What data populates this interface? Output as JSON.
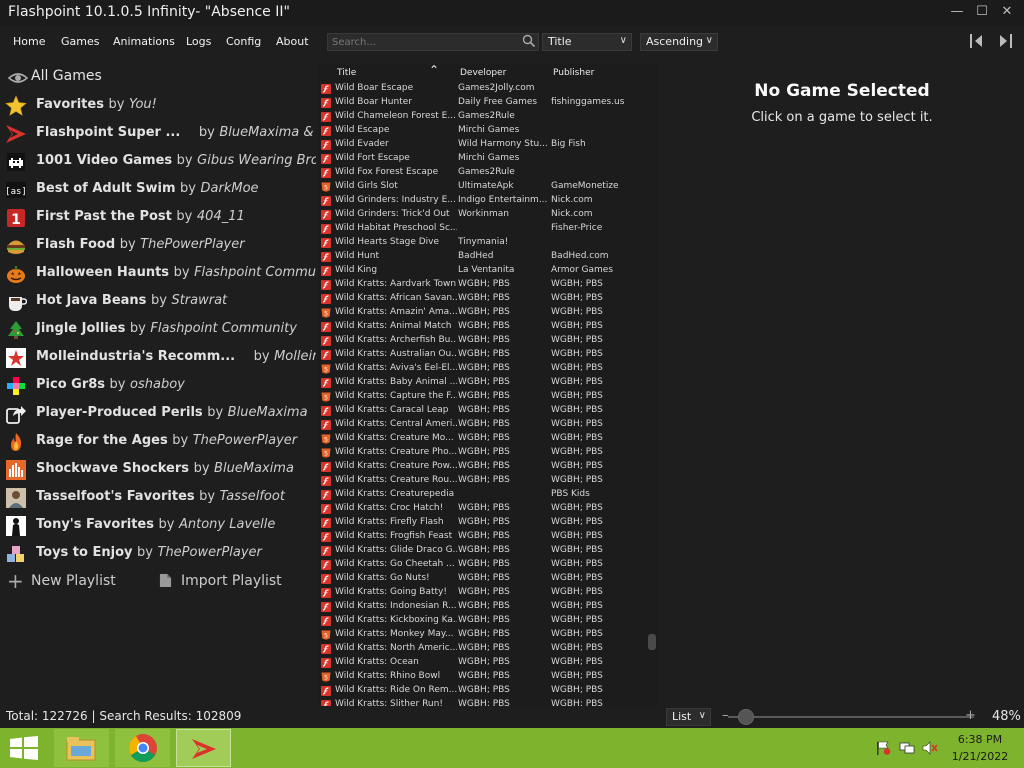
{
  "window": {
    "title": "Flashpoint 10.1.0.5 Infinity- \"Absence II\"",
    "minimize": "—",
    "maximize": "☐",
    "close": "✕"
  },
  "menu": {
    "items": [
      "Home",
      "Games",
      "Animations",
      "Logs",
      "Config",
      "About"
    ],
    "search_placeholder": "Search...",
    "order_by": "Title",
    "order_direction": "Ascending"
  },
  "playlists": {
    "all_games": "All Games",
    "items": [
      {
        "name": "Favorites",
        "by": "by",
        "author": "You!",
        "icon": "star-icon"
      },
      {
        "name": "Flashpoint Super ...",
        "by": "by",
        "author": "BlueMaxima & Fla...",
        "icon": "flashpoint-logo-icon"
      },
      {
        "name": "1001 Video Games",
        "by": "by",
        "author": "Gibus Wearing Brony",
        "icon": "space-invader-icon"
      },
      {
        "name": "Best of Adult Swim",
        "by": "by",
        "author": "DarkMoe",
        "icon": "adult-swim-icon"
      },
      {
        "name": "First Past the Post",
        "by": "by",
        "author": "404_11",
        "icon": "number-one-icon"
      },
      {
        "name": "Flash Food",
        "by": "by",
        "author": "ThePowerPlayer",
        "icon": "burger-icon"
      },
      {
        "name": "Halloween Haunts",
        "by": "by",
        "author": "Flashpoint Community",
        "icon": "pumpkin-icon"
      },
      {
        "name": "Hot Java Beans",
        "by": "by",
        "author": "Strawrat",
        "icon": "coffee-cup-icon"
      },
      {
        "name": "Jingle Jollies",
        "by": "by",
        "author": "Flashpoint Community",
        "icon": "christmas-tree-icon"
      },
      {
        "name": "Molleindustria's Recomm...",
        "by": "by",
        "author": "Molleind...",
        "icon": "molleindustria-icon"
      },
      {
        "name": "Pico Gr8s",
        "by": "by",
        "author": "oshaboy",
        "icon": "pico-icon"
      },
      {
        "name": "Player-Produced Perils",
        "by": "by",
        "author": "BlueMaxima",
        "icon": "share-arrow-icon"
      },
      {
        "name": "Rage for the Ages",
        "by": "by",
        "author": "ThePowerPlayer",
        "icon": "fire-icon"
      },
      {
        "name": "Shockwave Shockers",
        "by": "by",
        "author": "BlueMaxima",
        "icon": "shockwave-icon"
      },
      {
        "name": "Tasselfoot's Favorites",
        "by": "by",
        "author": "Tasselfoot",
        "icon": "tasselfoot-avatar-icon"
      },
      {
        "name": "Tony's Favorites",
        "by": "by",
        "author": "Antony Lavelle",
        "icon": "silhouette-icon"
      },
      {
        "name": "Toys to Enjoy",
        "by": "by",
        "author": "ThePowerPlayer",
        "icon": "toy-blocks-icon"
      }
    ],
    "new_playlist": "New Playlist",
    "import_playlist": "Import Playlist"
  },
  "game_list": {
    "columns": {
      "title": "Title",
      "developer": "Developer",
      "publisher": "Publisher"
    },
    "rows": [
      {
        "t": "Wild Boar Escape",
        "d": "Games2Jolly.com",
        "p": "",
        "k": "flash"
      },
      {
        "t": "Wild Boar Hunter",
        "d": "Daily Free Games",
        "p": "fishinggames.us",
        "k": "flash"
      },
      {
        "t": "Wild Chameleon Forest E...",
        "d": "Games2Rule",
        "p": "",
        "k": "flash"
      },
      {
        "t": "Wild Escape",
        "d": "Mirchi Games",
        "p": "",
        "k": "flash"
      },
      {
        "t": "Wild Evader",
        "d": "Wild Harmony Stu...",
        "p": "Big Fish",
        "k": "flash"
      },
      {
        "t": "Wild Fort Escape",
        "d": "Mirchi Games",
        "p": "",
        "k": "flash"
      },
      {
        "t": "Wild Fox Forest Escape",
        "d": "Games2Rule",
        "p": "",
        "k": "flash"
      },
      {
        "t": "Wild Girls Slot",
        "d": "UltimateApk",
        "p": "GameMonetize",
        "k": "html5"
      },
      {
        "t": "Wild Grinders: Industry E...",
        "d": "Indigo Entertainm...",
        "p": "Nick.com",
        "k": "flash"
      },
      {
        "t": "Wild Grinders: Trick'd Out",
        "d": "Workinman",
        "p": "Nick.com",
        "k": "flash"
      },
      {
        "t": "Wild Habitat Preschool Sc...",
        "d": "",
        "p": "Fisher-Price",
        "k": "flash"
      },
      {
        "t": "Wild Hearts Stage Dive",
        "d": "Tinymania!",
        "p": "",
        "k": "flash"
      },
      {
        "t": "Wild Hunt",
        "d": "BadHed",
        "p": "BadHed.com",
        "k": "flash"
      },
      {
        "t": "Wild King",
        "d": "La Ventanita",
        "p": "Armor Games",
        "k": "flash"
      },
      {
        "t": "Wild Kratts: Aardvark Town",
        "d": "WGBH; PBS",
        "p": "WGBH; PBS",
        "k": "flash"
      },
      {
        "t": "Wild Kratts: African Savan...",
        "d": "WGBH; PBS",
        "p": "WGBH; PBS",
        "k": "flash"
      },
      {
        "t": "Wild Kratts: Amazin' Ama...",
        "d": "WGBH; PBS",
        "p": "WGBH; PBS",
        "k": "html5"
      },
      {
        "t": "Wild Kratts: Animal Match",
        "d": "WGBH; PBS",
        "p": "WGBH; PBS",
        "k": "flash"
      },
      {
        "t": "Wild Kratts: Archerfish Bu...",
        "d": "WGBH; PBS",
        "p": "WGBH; PBS",
        "k": "flash"
      },
      {
        "t": "Wild Kratts: Australian Ou...",
        "d": "WGBH; PBS",
        "p": "WGBH; PBS",
        "k": "flash"
      },
      {
        "t": "Wild Kratts: Aviva's Eel-El...",
        "d": "WGBH; PBS",
        "p": "WGBH; PBS",
        "k": "html5"
      },
      {
        "t": "Wild Kratts: Baby Animal ...",
        "d": "WGBH; PBS",
        "p": "WGBH; PBS",
        "k": "flash"
      },
      {
        "t": "Wild Kratts: Capture the F...",
        "d": "WGBH; PBS",
        "p": "WGBH; PBS",
        "k": "html5"
      },
      {
        "t": "Wild Kratts: Caracal Leap",
        "d": "WGBH; PBS",
        "p": "WGBH; PBS",
        "k": "flash"
      },
      {
        "t": "Wild Kratts: Central Ameri...",
        "d": "WGBH; PBS",
        "p": "WGBH; PBS",
        "k": "flash"
      },
      {
        "t": "Wild Kratts: Creature Mo...",
        "d": "WGBH; PBS",
        "p": "WGBH; PBS",
        "k": "html5"
      },
      {
        "t": "Wild Kratts: Creature Pho...",
        "d": "WGBH; PBS",
        "p": "WGBH; PBS",
        "k": "html5"
      },
      {
        "t": "Wild Kratts: Creature Pow...",
        "d": "WGBH; PBS",
        "p": "WGBH; PBS",
        "k": "flash"
      },
      {
        "t": "Wild Kratts: Creature Rou...",
        "d": "WGBH; PBS",
        "p": "WGBH; PBS",
        "k": "flash"
      },
      {
        "t": "Wild Kratts: Creaturepedia",
        "d": "",
        "p": "PBS Kids",
        "k": "flash"
      },
      {
        "t": "Wild Kratts: Croc Hatch!",
        "d": "WGBH; PBS",
        "p": "WGBH; PBS",
        "k": "flash"
      },
      {
        "t": "Wild Kratts: Firefly Flash",
        "d": "WGBH; PBS",
        "p": "WGBH; PBS",
        "k": "flash"
      },
      {
        "t": "Wild Kratts: Frogfish Feast",
        "d": "WGBH; PBS",
        "p": "WGBH; PBS",
        "k": "flash"
      },
      {
        "t": "Wild Kratts: Glide Draco G...",
        "d": "WGBH; PBS",
        "p": "WGBH; PBS",
        "k": "flash"
      },
      {
        "t": "Wild Kratts: Go Cheetah ...",
        "d": "WGBH; PBS",
        "p": "WGBH; PBS",
        "k": "flash"
      },
      {
        "t": "Wild Kratts: Go Nuts!",
        "d": "WGBH; PBS",
        "p": "WGBH; PBS",
        "k": "flash"
      },
      {
        "t": "Wild Kratts: Going Batty!",
        "d": "WGBH; PBS",
        "p": "WGBH; PBS",
        "k": "flash"
      },
      {
        "t": "Wild Kratts: Indonesian R...",
        "d": "WGBH; PBS",
        "p": "WGBH; PBS",
        "k": "flash"
      },
      {
        "t": "Wild Kratts: Kickboxing Ka...",
        "d": "WGBH; PBS",
        "p": "WGBH; PBS",
        "k": "flash"
      },
      {
        "t": "Wild Kratts: Monkey May...",
        "d": "WGBH; PBS",
        "p": "WGBH; PBS",
        "k": "html5"
      },
      {
        "t": "Wild Kratts: North Americ...",
        "d": "WGBH; PBS",
        "p": "WGBH; PBS",
        "k": "flash"
      },
      {
        "t": "Wild Kratts: Ocean",
        "d": "WGBH; PBS",
        "p": "WGBH; PBS",
        "k": "flash"
      },
      {
        "t": "Wild Kratts: Rhino Bowl",
        "d": "WGBH; PBS",
        "p": "WGBH; PBS",
        "k": "html5"
      },
      {
        "t": "Wild Kratts: Ride On Rem...",
        "d": "WGBH; PBS",
        "p": "WGBH; PBS",
        "k": "flash"
      },
      {
        "t": "Wild Kratts: Slither Run!",
        "d": "WGBH; PBS",
        "p": "WGBH; PBS",
        "k": "flash"
      }
    ]
  },
  "details": {
    "heading": "No Game Selected",
    "subheading": "Click on a game to select it."
  },
  "status": {
    "text": "Total: 122726  |  Search Results: 102809",
    "layout": "List",
    "zoom": "48%",
    "zoom_level": 0.05
  },
  "taskbar": {
    "time": "6:38 PM",
    "date": "1/21/2022"
  },
  "colors": {
    "background": "#1e1e1e",
    "taskbar": "#7db32d",
    "flash_icon": "#d8342c",
    "html5_icon": "#e5622a"
  }
}
